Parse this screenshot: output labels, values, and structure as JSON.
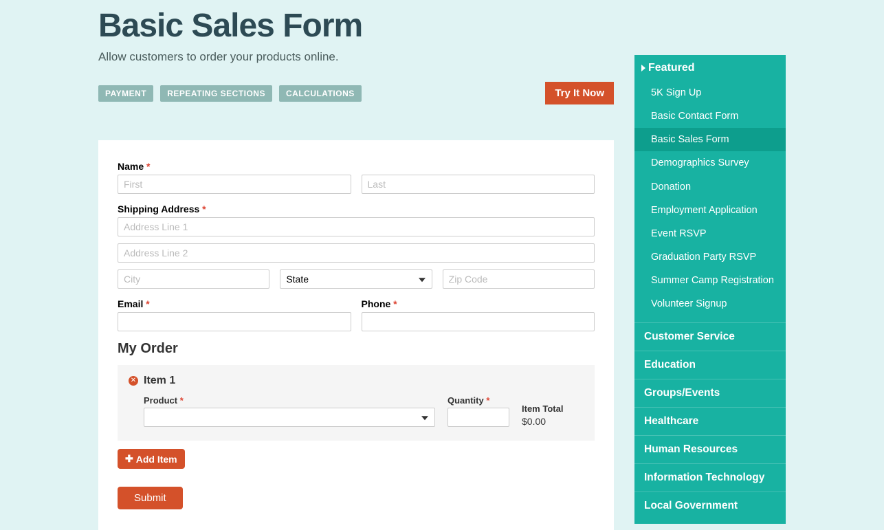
{
  "page": {
    "title": "Basic Sales Form",
    "subtitle": "Allow customers to order your products online.",
    "try_button": "Try It Now"
  },
  "tags": [
    "PAYMENT",
    "REPEATING SECTIONS",
    "CALCULATIONS"
  ],
  "form": {
    "name": {
      "label": "Name",
      "first_ph": "First",
      "last_ph": "Last"
    },
    "shipping": {
      "label": "Shipping Address",
      "line1_ph": "Address Line 1",
      "line2_ph": "Address Line 2",
      "city_ph": "City",
      "state_label": "State",
      "zip_ph": "Zip Code"
    },
    "email_label": "Email",
    "phone_label": "Phone",
    "order_heading": "My Order",
    "item": {
      "title": "Item 1",
      "product_label": "Product",
      "quantity_label": "Quantity",
      "total_label": "Item Total",
      "total_value": "$0.00"
    },
    "add_item": "Add Item",
    "submit": "Submit"
  },
  "sidebar": {
    "featured_label": "Featured",
    "featured_items": [
      {
        "label": "5K Sign Up",
        "active": false
      },
      {
        "label": "Basic Contact Form",
        "active": false
      },
      {
        "label": "Basic Sales Form",
        "active": true
      },
      {
        "label": "Demographics Survey",
        "active": false
      },
      {
        "label": "Donation",
        "active": false
      },
      {
        "label": "Employment Application",
        "active": false
      },
      {
        "label": "Event RSVP",
        "active": false
      },
      {
        "label": "Graduation Party RSVP",
        "active": false
      },
      {
        "label": "Summer Camp Registration",
        "active": false
      },
      {
        "label": "Volunteer Signup",
        "active": false
      }
    ],
    "categories": [
      "Customer Service",
      "Education",
      "Groups/Events",
      "Healthcare",
      "Human Resources",
      "Information Technology",
      "Local Government"
    ]
  }
}
